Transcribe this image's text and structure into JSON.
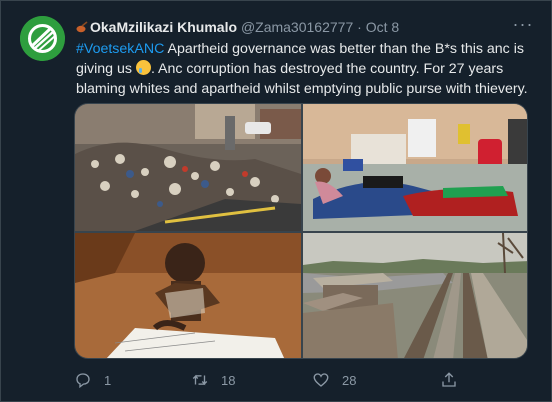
{
  "tweet": {
    "author_name": "OkaMzilikazi Khumalo",
    "handle": "@Zama30162777",
    "separator": "·",
    "date": "Oct 8",
    "more_label": "···",
    "hashtag": "#VoetsekANC",
    "text_part1": " Apartheid governance was better than the B*s this anc is giving us ",
    "text_part2": ". Anc corruption has destroyed the country. For 27 years blaming whites and apartheid whilst emptying public purse with thievery."
  },
  "actions": {
    "reply_count": "1",
    "retweet_count": "18",
    "like_count": "28"
  },
  "colors": {
    "background": "#15202b",
    "accent": "#1d9bf0",
    "muted": "#8b98a5",
    "text": "#e7e9ea",
    "avatar_green": "#2e9e3e"
  },
  "icons": {
    "reply": "reply-icon",
    "retweet": "retweet-icon",
    "like": "heart-icon",
    "share": "share-icon"
  }
}
